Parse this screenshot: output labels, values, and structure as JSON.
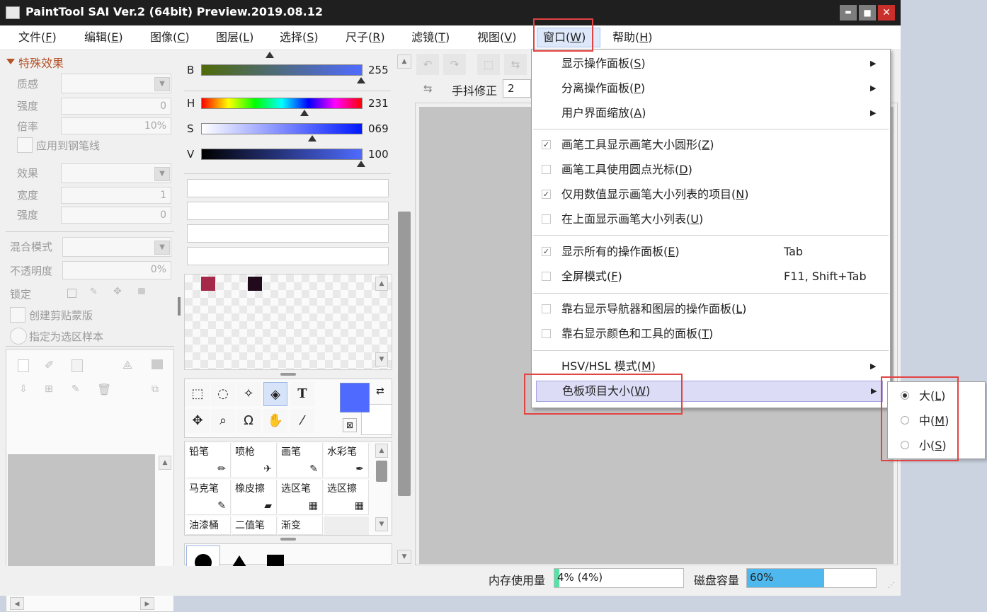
{
  "window": {
    "title": "PaintTool SAI Ver.2 (64bit) Preview.2019.08.12",
    "minimize_label": "▬",
    "maximize_label": "■",
    "close_label": "✕"
  },
  "menubar": [
    {
      "label": "文件(",
      "key": "F"
    },
    {
      "label": "编辑(",
      "key": "E"
    },
    {
      "label": "图像(",
      "key": "C"
    },
    {
      "label": "图层(",
      "key": "L"
    },
    {
      "label": "选择(",
      "key": "S"
    },
    {
      "label": "尺子(",
      "key": "R"
    },
    {
      "label": "滤镜(",
      "key": "T"
    },
    {
      "label": "视图(",
      "key": "V"
    },
    {
      "label": "窗口(",
      "key": "W"
    },
    {
      "label": "帮助(",
      "key": "H"
    }
  ],
  "left_panel": {
    "section_title": "特殊效果",
    "texture_label": "质感",
    "strength_label": "强度",
    "strength_value": "0",
    "scale_label": "倍率",
    "scale_value": "10%",
    "apply_to_pen_label": "应用到钢笔线",
    "effect_label": "效果",
    "width_label": "宽度",
    "width_value": "1",
    "strength2_label": "强度",
    "strength2_value": "0",
    "blend_mode_label": "混合模式",
    "opacity_label": "不透明度",
    "opacity_value": "0%",
    "lock_label": "锁定",
    "clipping_label": "创建剪贴蒙版",
    "selection_sample_label": "指定为选区样本"
  },
  "color_panel": {
    "b_label": "B",
    "b_value": "255",
    "h_label": "H",
    "h_value": "231",
    "s_label": "S",
    "s_value": "069",
    "v_label": "V",
    "v_value": "100",
    "swatch1": "#a52a4a",
    "swatch2": "#200a1c",
    "fg_color": "#4f6bff",
    "bg_color": "#ffffff"
  },
  "brushes": [
    {
      "label": "铅笔"
    },
    {
      "label": "喷枪"
    },
    {
      "label": "画笔"
    },
    {
      "label": "水彩笔"
    },
    {
      "label": "马克笔"
    },
    {
      "label": "橡皮擦"
    },
    {
      "label": "选区笔"
    },
    {
      "label": "选区擦"
    },
    {
      "label": "油漆桶"
    },
    {
      "label": "二值笔"
    },
    {
      "label": "渐变"
    }
  ],
  "toolbar": {
    "stabilizer_label": "手抖修正",
    "stabilizer_value": "2"
  },
  "window_menu": {
    "items": [
      {
        "label": "显示操作面板(",
        "key": "S",
        "submenu": true
      },
      {
        "label": "分离操作面板(",
        "key": "P",
        "submenu": true
      },
      {
        "label": "用户界面缩放(",
        "key": "A",
        "submenu": true
      },
      {
        "label": "画笔工具显示画笔大小圆形(",
        "key": "Z",
        "checked": true
      },
      {
        "label": "画笔工具使用圆点光标(",
        "key": "D",
        "checked": false
      },
      {
        "label": "仅用数值显示画笔大小列表的项目(",
        "key": "N",
        "checked": true
      },
      {
        "label": "在上面显示画笔大小列表(",
        "key": "U",
        "checked": false
      },
      {
        "label": "显示所有的操作面板(",
        "key": "E",
        "checked": true,
        "shortcut": "Tab"
      },
      {
        "label": "全屏模式(",
        "key": "F",
        "checked": false,
        "shortcut": "F11, Shift+Tab"
      },
      {
        "label": "靠右显示导航器和图层的操作面板(",
        "key": "L",
        "checked": false
      },
      {
        "label": "靠右显示颜色和工具的面板(",
        "key": "T",
        "checked": false
      },
      {
        "label": "HSV/HSL 模式(",
        "key": "M",
        "submenu": true
      },
      {
        "label": "色板项目大小(",
        "key": "W",
        "submenu": true
      }
    ],
    "check_mark": "✓",
    "arrow": "▶"
  },
  "swatch_size_submenu": [
    {
      "label": "大(",
      "key": "L",
      "selected": true
    },
    {
      "label": "中(",
      "key": "M",
      "selected": false
    },
    {
      "label": "小(",
      "key": "S",
      "selected": false
    }
  ],
  "statusbar": {
    "memory_label": "内存使用量",
    "memory_value": "4% (4%)",
    "memory_fraction": 0.04,
    "disk_label": "磁盘容量",
    "disk_value": "60%",
    "disk_fraction": 0.6
  },
  "accent_color": "#4fb8ef",
  "highlight_color": "#e24343"
}
